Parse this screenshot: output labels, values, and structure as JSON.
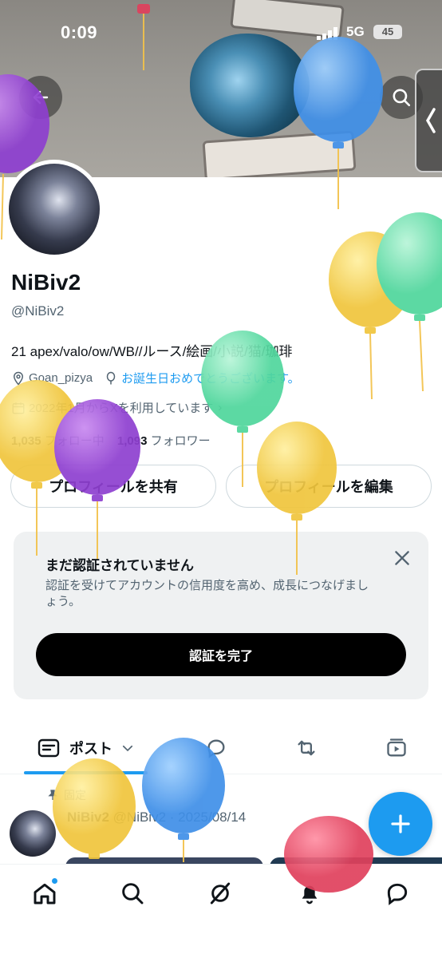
{
  "status_bar": {
    "time": "0:09",
    "network": "5G",
    "battery": "45"
  },
  "profile": {
    "name": "NiBiv2",
    "handle": "@NiBiv2",
    "bio": "21 apex/valo/ow/WB//ルース/絵画/小説/猫/珈琲",
    "location": "Goan_pizya",
    "birthday_link": "お誕生日おめでとうございます。",
    "joined": "2022年1月からXを利用しています",
    "following_count": "1,035",
    "following_label": "フォロー中",
    "followers_count": "1,093",
    "followers_label": "フォロワー"
  },
  "buttons": {
    "share_profile": "プロフィールを共有",
    "edit_profile": "プロフィールを編集"
  },
  "verify_card": {
    "title": "まだ認証されていません",
    "description": "認証を受けてアカウントの信用度を高め、成長につなげましょう。",
    "cta": "認証を完了"
  },
  "tabs": {
    "posts_label": "ポスト"
  },
  "pinned_post": {
    "pinned_label": "固定",
    "author_name": "NiBiv2",
    "author_handle": "@NiBiv2",
    "date": "2025/08/14"
  },
  "colors": {
    "accent": "#1d9bf0",
    "text": "#0f1419",
    "secondary": "#536471",
    "card_bg": "#eff1f2"
  },
  "icons": [
    "back-arrow-icon",
    "search-icon",
    "chevron-left-icon",
    "location-pin-icon",
    "balloon-icon",
    "calendar-icon",
    "close-icon",
    "posts-icon",
    "chevron-down-icon",
    "replies-icon",
    "repost-icon",
    "media-icon",
    "pin-icon",
    "plus-icon",
    "home-icon",
    "grok-icon",
    "bell-icon",
    "messages-icon"
  ]
}
